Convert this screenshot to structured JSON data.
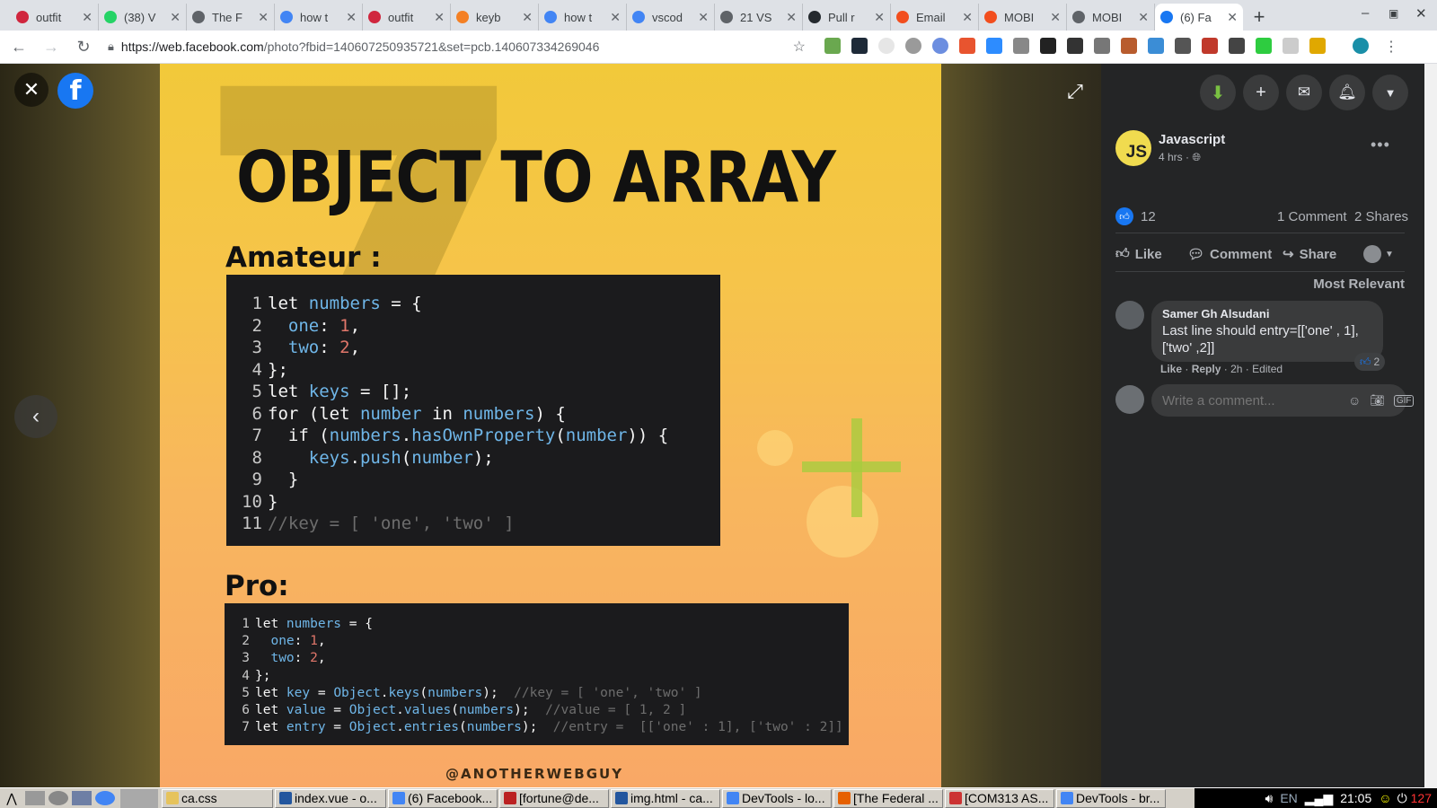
{
  "browser": {
    "tabs": [
      {
        "title": "outfit",
        "icon": "opera-icon",
        "color": "#d0263e"
      },
      {
        "title": "(38) V",
        "icon": "whatsapp-icon",
        "color": "#25d366"
      },
      {
        "title": "The F",
        "icon": "document-icon",
        "color": "#5f6368"
      },
      {
        "title": "how t",
        "icon": "google-icon",
        "color": "#4285f4"
      },
      {
        "title": "outfit",
        "icon": "opera-icon",
        "color": "#d0263e"
      },
      {
        "title": "keyb",
        "icon": "stackoverflow-icon",
        "color": "#f48024"
      },
      {
        "title": "how t",
        "icon": "google-icon",
        "color": "#4285f4"
      },
      {
        "title": "vscod",
        "icon": "google-icon",
        "color": "#4285f4"
      },
      {
        "title": "21 VS",
        "icon": "dash-icon",
        "color": "#5f6368"
      },
      {
        "title": "Pull r",
        "icon": "github-icon",
        "color": "#24292e"
      },
      {
        "title": "Email",
        "icon": "figma-icon",
        "color": "#f24e1e"
      },
      {
        "title": "MOBI",
        "icon": "figma-icon",
        "color": "#f24e1e"
      },
      {
        "title": "MOBI",
        "icon": "globe-icon",
        "color": "#5f6368"
      },
      {
        "title": "(6) Fa",
        "icon": "facebook-icon",
        "color": "#1877f2",
        "active": true
      }
    ],
    "url_host": "https://web.facebook.com",
    "url_rest": "/photo?fbid=140607250935721&set=pcb.140607334269046"
  },
  "photo": {
    "title": "OBJECT TO ARRAY",
    "amateur_heading": "Amateur :",
    "pro_heading": "Pro:",
    "amateur_code": [
      {
        "n": "1",
        "code": [
          [
            "kw",
            "let "
          ],
          [
            "id",
            "numbers"
          ],
          [
            "kw",
            " = {"
          ]
        ]
      },
      {
        "n": "2",
        "code": [
          [
            "kw",
            "  "
          ],
          [
            "id",
            "one"
          ],
          [
            "kw",
            ": "
          ],
          [
            "nm",
            "1"
          ],
          [
            "kw",
            ","
          ]
        ]
      },
      {
        "n": "3",
        "code": [
          [
            "kw",
            "  "
          ],
          [
            "id",
            "two"
          ],
          [
            "kw",
            ": "
          ],
          [
            "nm",
            "2"
          ],
          [
            "kw",
            ","
          ]
        ]
      },
      {
        "n": "4",
        "code": [
          [
            "kw",
            "};"
          ]
        ]
      },
      {
        "n": "5",
        "code": [
          [
            "kw",
            "let "
          ],
          [
            "id",
            "keys"
          ],
          [
            "kw",
            " = [];"
          ]
        ]
      },
      {
        "n": "6",
        "code": [
          [
            "kw",
            "for (let "
          ],
          [
            "id",
            "number"
          ],
          [
            "kw",
            " in "
          ],
          [
            "id",
            "numbers"
          ],
          [
            "kw",
            ") {"
          ]
        ]
      },
      {
        "n": "7",
        "code": [
          [
            "kw",
            "  if ("
          ],
          [
            "id",
            "numbers"
          ],
          [
            "kw",
            "."
          ],
          [
            "id",
            "hasOwnProperty"
          ],
          [
            "kw",
            "("
          ],
          [
            "id",
            "number"
          ],
          [
            "kw",
            ")) {"
          ]
        ]
      },
      {
        "n": "8",
        "code": [
          [
            "kw",
            "    "
          ],
          [
            "id",
            "keys"
          ],
          [
            "kw",
            "."
          ],
          [
            "id",
            "push"
          ],
          [
            "kw",
            "("
          ],
          [
            "id",
            "number"
          ],
          [
            "kw",
            ");"
          ]
        ]
      },
      {
        "n": "9",
        "code": [
          [
            "kw",
            "  }"
          ]
        ]
      },
      {
        "n": "10",
        "code": [
          [
            "kw",
            "}"
          ]
        ]
      },
      {
        "n": "11",
        "code": [
          [
            "cm",
            "//key = [ 'one', 'two' ]"
          ]
        ]
      }
    ],
    "pro_code": [
      {
        "n": "1",
        "code": [
          [
            "kw",
            "let "
          ],
          [
            "id",
            "numbers"
          ],
          [
            "kw",
            " = {"
          ]
        ]
      },
      {
        "n": "2",
        "code": [
          [
            "kw",
            "  "
          ],
          [
            "id",
            "one"
          ],
          [
            "kw",
            ": "
          ],
          [
            "nm",
            "1"
          ],
          [
            "kw",
            ","
          ]
        ]
      },
      {
        "n": "3",
        "code": [
          [
            "kw",
            "  "
          ],
          [
            "id",
            "two"
          ],
          [
            "kw",
            ": "
          ],
          [
            "nm",
            "2"
          ],
          [
            "kw",
            ","
          ]
        ]
      },
      {
        "n": "4",
        "code": [
          [
            "kw",
            "};"
          ]
        ]
      },
      {
        "n": "5",
        "code": [
          [
            "kw",
            "let "
          ],
          [
            "id",
            "key"
          ],
          [
            "kw",
            " = "
          ],
          [
            "id",
            "Object"
          ],
          [
            "kw",
            "."
          ],
          [
            "id",
            "keys"
          ],
          [
            "kw",
            "("
          ],
          [
            "id",
            "numbers"
          ],
          [
            "kw",
            ");  "
          ],
          [
            "cm",
            "//key = [ 'one', 'two' ]"
          ]
        ]
      },
      {
        "n": "6",
        "code": [
          [
            "kw",
            "let "
          ],
          [
            "id",
            "value"
          ],
          [
            "kw",
            " = "
          ],
          [
            "id",
            "Object"
          ],
          [
            "kw",
            "."
          ],
          [
            "id",
            "values"
          ],
          [
            "kw",
            "("
          ],
          [
            "id",
            "numbers"
          ],
          [
            "kw",
            ");  "
          ],
          [
            "cm",
            "//value = [ 1, 2 ]"
          ]
        ]
      },
      {
        "n": "7",
        "code": [
          [
            "kw",
            "let "
          ],
          [
            "id",
            "entry"
          ],
          [
            "kw",
            " = "
          ],
          [
            "id",
            "Object"
          ],
          [
            "kw",
            "."
          ],
          [
            "id",
            "entries"
          ],
          [
            "kw",
            "("
          ],
          [
            "id",
            "numbers"
          ],
          [
            "kw",
            ");  "
          ],
          [
            "cm",
            "//entry =  [['one' : 1], ['two' : 2]]"
          ]
        ]
      }
    ],
    "watermark": "@ANOTHERWEBGUY"
  },
  "post": {
    "author": "Javascript",
    "avatar_text": "JS",
    "time": "4 hrs · ",
    "reactions_count": "12",
    "comments_count": "1 Comment",
    "shares_count": "2 Shares",
    "like_label": "Like",
    "comment_label": "Comment",
    "share_label": "Share",
    "sort_label": "Most Relevant"
  },
  "comment": {
    "author": "Samer Gh Alsudani",
    "text": "Last line should entry=[['one' , 1], ['two' ,2]]",
    "like": "Like",
    "reply": "Reply",
    "meta": "· 2h · Edited",
    "reactions": "2"
  },
  "compose": {
    "placeholder": "Write a comment..."
  },
  "taskbar": {
    "items": [
      {
        "label": "ca.css",
        "color": "#e6c35c"
      },
      {
        "label": "index.vue - o...",
        "color": "#23569e"
      },
      {
        "label": "(6) Facebook...",
        "color": "#4285f4"
      },
      {
        "label": "[fortune@de...",
        "color": "#b22"
      },
      {
        "label": "img.html - ca...",
        "color": "#23569e"
      },
      {
        "label": "DevTools - lo...",
        "color": "#4285f4"
      },
      {
        "label": "[The Federal ...",
        "color": "#e66000"
      },
      {
        "label": "[COM313 AS...",
        "color": "#c33"
      },
      {
        "label": "DevTools - br...",
        "color": "#4285f4"
      }
    ],
    "lang": "EN",
    "clock": "21:05",
    "badge": "127"
  }
}
